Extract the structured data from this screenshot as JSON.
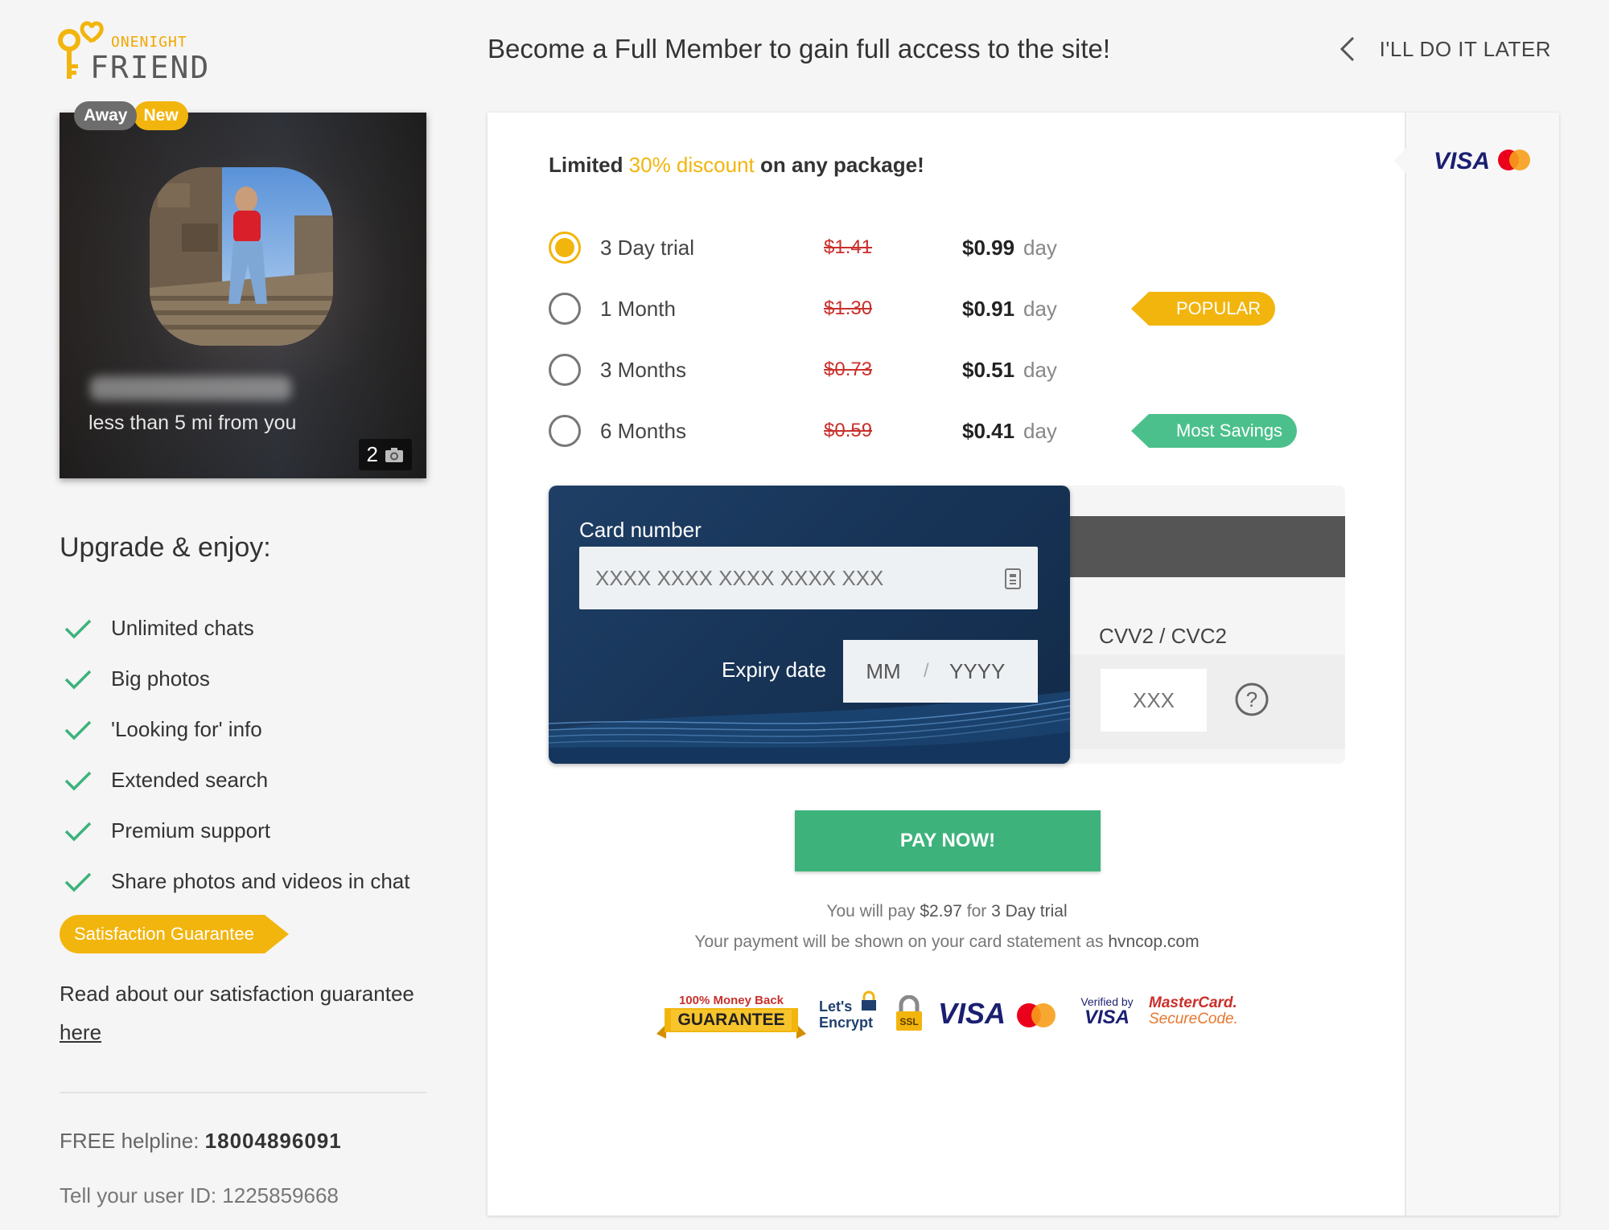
{
  "brand": {
    "top": "ONENIGHT",
    "bottom": "FRIEND"
  },
  "header": {
    "title": "Become a Full Member to gain full access to the site!",
    "later_label": "I'LL DO IT LATER"
  },
  "profile": {
    "badges": [
      "Away",
      "New"
    ],
    "distance": "less than 5 mi from you",
    "photo_count": "2"
  },
  "upgrade": {
    "title": "Upgrade & enjoy:",
    "features": [
      "Unlimited chats",
      "Big photos",
      "'Looking for' info",
      "Extended search",
      "Premium support",
      "Share photos and videos in chat"
    ],
    "guarantee_tag": "Satisfaction Guarantee",
    "read_text": "Read about our satisfaction guarantee",
    "read_link": "here"
  },
  "support": {
    "helpline_label": "FREE helpline:",
    "helpline_number": "18004896091",
    "userid_text": "Tell your user ID: 1225859668"
  },
  "offer": {
    "prefix": "Limited ",
    "highlight": "30% discount",
    "suffix": " on any package!"
  },
  "plans": [
    {
      "name": "3 Day trial",
      "old_price": "$1.41",
      "price": "$0.99",
      "unit": "day",
      "selected": true,
      "tag": ""
    },
    {
      "name": "1 Month",
      "old_price": "$1.30",
      "price": "$0.91",
      "unit": "day",
      "selected": false,
      "tag": "POPULAR"
    },
    {
      "name": "3 Months",
      "old_price": "$0.73",
      "price": "$0.51",
      "unit": "day",
      "selected": false,
      "tag": ""
    },
    {
      "name": "6 Months",
      "old_price": "$0.59",
      "price": "$0.41",
      "unit": "day",
      "selected": false,
      "tag": "Most Savings"
    }
  ],
  "card": {
    "number_label": "Card number",
    "number_placeholder": "XXXX XXXX XXXX XXXX XXX",
    "expiry_label": "Expiry date",
    "mm_placeholder": "MM",
    "separator": "/",
    "yyyy_placeholder": "YYYY",
    "cvv_label": "CVV2 / CVC2",
    "cvv_placeholder": "XXX"
  },
  "payment": {
    "button_label": "PAY NOW!",
    "note_prefix": "You will pay ",
    "note_amount": "$2.97",
    "note_mid": " for ",
    "note_plan": "3 Day trial",
    "statement_prefix": "Your payment will be shown on your card statement as ",
    "statement_domain": "hvncop.com"
  },
  "trust_badges": {
    "money_back": "100% Money Back",
    "guarantee": "GUARANTEE",
    "lets": "Let's",
    "encrypt": "Encrypt",
    "ssl": "SSL",
    "visa": "VISA",
    "verified_by": "Verified by",
    "verified_visa": "VISA",
    "mastercard": "MasterCard.",
    "securecode": "SecureCode."
  },
  "colors": {
    "accent": "#f2b50d",
    "green": "#3db27b",
    "tag_green": "#4cc08c",
    "card_blue": "#173457",
    "strike_red": "#c9302c"
  }
}
